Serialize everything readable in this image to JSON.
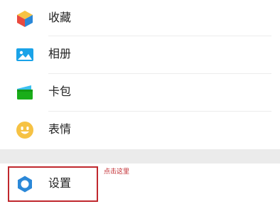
{
  "menu": {
    "items": [
      {
        "label": "收藏",
        "icon": "favorites-cube-icon"
      },
      {
        "label": "相册",
        "icon": "album-photo-icon"
      },
      {
        "label": "卡包",
        "icon": "card-wallet-icon"
      },
      {
        "label": "表情",
        "icon": "sticker-smiley-icon"
      }
    ],
    "settings": {
      "label": "设置",
      "icon": "gear-icon"
    }
  },
  "annotation": {
    "text": "点击这里",
    "color": "#c0282d"
  },
  "colors": {
    "divider": "#ececec",
    "section_gap": "#ebebeb",
    "text": "#222222",
    "accent_blue": "#1aa3e8",
    "accent_green": "#1aad19",
    "accent_yellow": "#f6c244"
  }
}
